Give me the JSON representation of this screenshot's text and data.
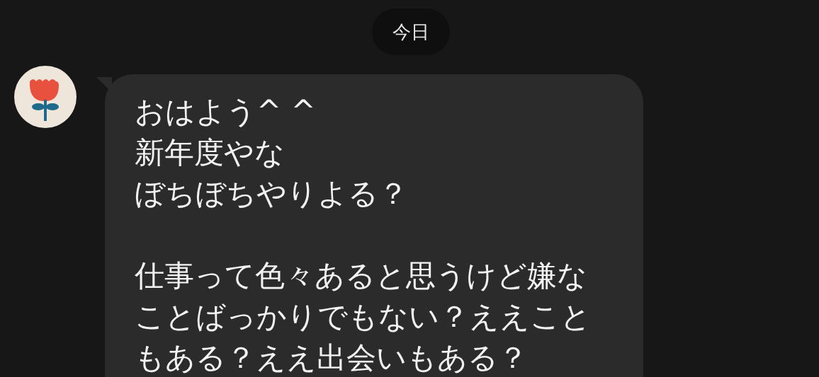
{
  "date_separator": "今日",
  "messages": [
    {
      "kind": "incoming",
      "paragraphs": [
        [
          "おはよう^ ^",
          "新年度やな",
          "ぼちぼちやりよる？"
        ],
        [
          "仕事って色々あると思うけど嫌な",
          "ことばっかりでもない？ええこと",
          "もある？ええ出会いもある？"
        ]
      ]
    }
  ]
}
